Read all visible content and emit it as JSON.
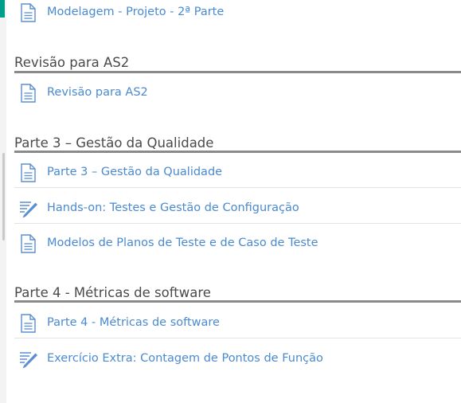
{
  "sections": [
    {
      "title": "Revisão para AS2",
      "items": [
        {
          "label": "Revisão para AS2",
          "icon": "page-icon"
        }
      ]
    },
    {
      "title": "Parte 3 – Gestão da Qualidade",
      "items": [
        {
          "label": "Parte 3 – Gestão da Qualidade",
          "icon": "page-icon"
        },
        {
          "label": "Hands-on: Testes e Gestão de Configuração",
          "icon": "assignment-icon"
        },
        {
          "label": "Modelos de Planos de Teste e de Caso de Teste",
          "icon": "page-icon"
        }
      ]
    },
    {
      "title": "Parte 4 - Métricas de software",
      "items": [
        {
          "label": "Parte 4 - Métricas de software",
          "icon": "page-icon"
        },
        {
          "label": "Exercício Extra: Contagem de Pontos de Função",
          "icon": "assignment-icon"
        }
      ]
    }
  ],
  "top_item": {
    "label": "Modelagem - Projeto - 2ª Parte",
    "icon": "page-icon"
  },
  "colors": {
    "link": "#4a8ad0",
    "heading": "#4a4a4a",
    "rule": "#8a8a8a",
    "accent": "#009f8c",
    "icon": "#5b8fd0"
  }
}
